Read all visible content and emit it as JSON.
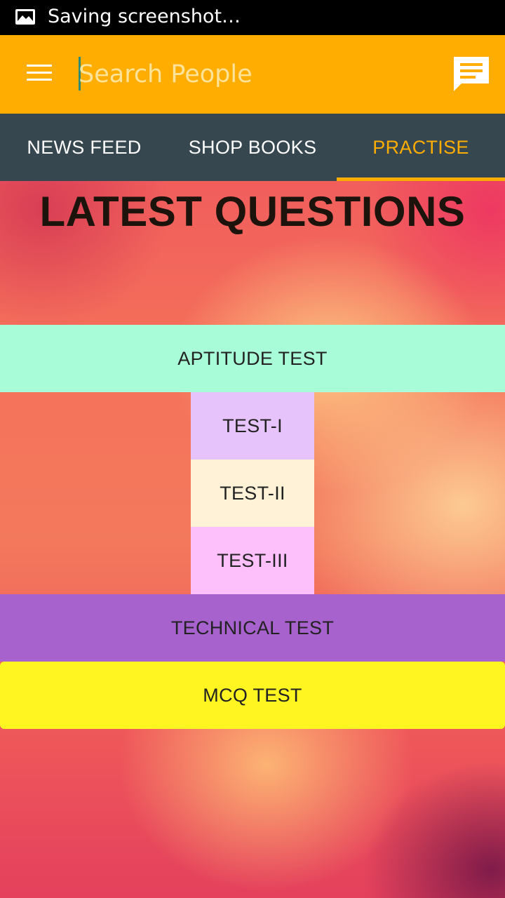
{
  "status_bar": {
    "notification_icon": "image-gallery-icon",
    "text": "Saving screenshot…"
  },
  "toolbar": {
    "menu_icon": "hamburger-menu-icon",
    "search": {
      "placeholder": "Search People",
      "value": ""
    },
    "chat_icon": "chat-message-icon",
    "background_color": "#ffad00"
  },
  "tabs": [
    {
      "label": "NEWS FEED",
      "active": false
    },
    {
      "label": "SHOP BOOKS",
      "active": false
    },
    {
      "label": "PRACTISE",
      "active": true
    }
  ],
  "tab_bar_color": "#37474f",
  "accent_color": "#ffad00",
  "main": {
    "title": "LATEST QUESTIONS",
    "sections": {
      "aptitude": {
        "label": "APTITUDE TEST",
        "color": "#a8fdd8"
      },
      "tests": [
        {
          "label": "TEST-I",
          "color": "#e7c3fb"
        },
        {
          "label": "TEST-II",
          "color": "#fff2d6"
        },
        {
          "label": "TEST-III",
          "color": "#fdc0fb"
        }
      ],
      "technical": {
        "label": "TECHNICAL TEST",
        "color": "#a762cd"
      },
      "mcq": {
        "label": "MCQ TEST",
        "color": "#fff521"
      }
    }
  }
}
